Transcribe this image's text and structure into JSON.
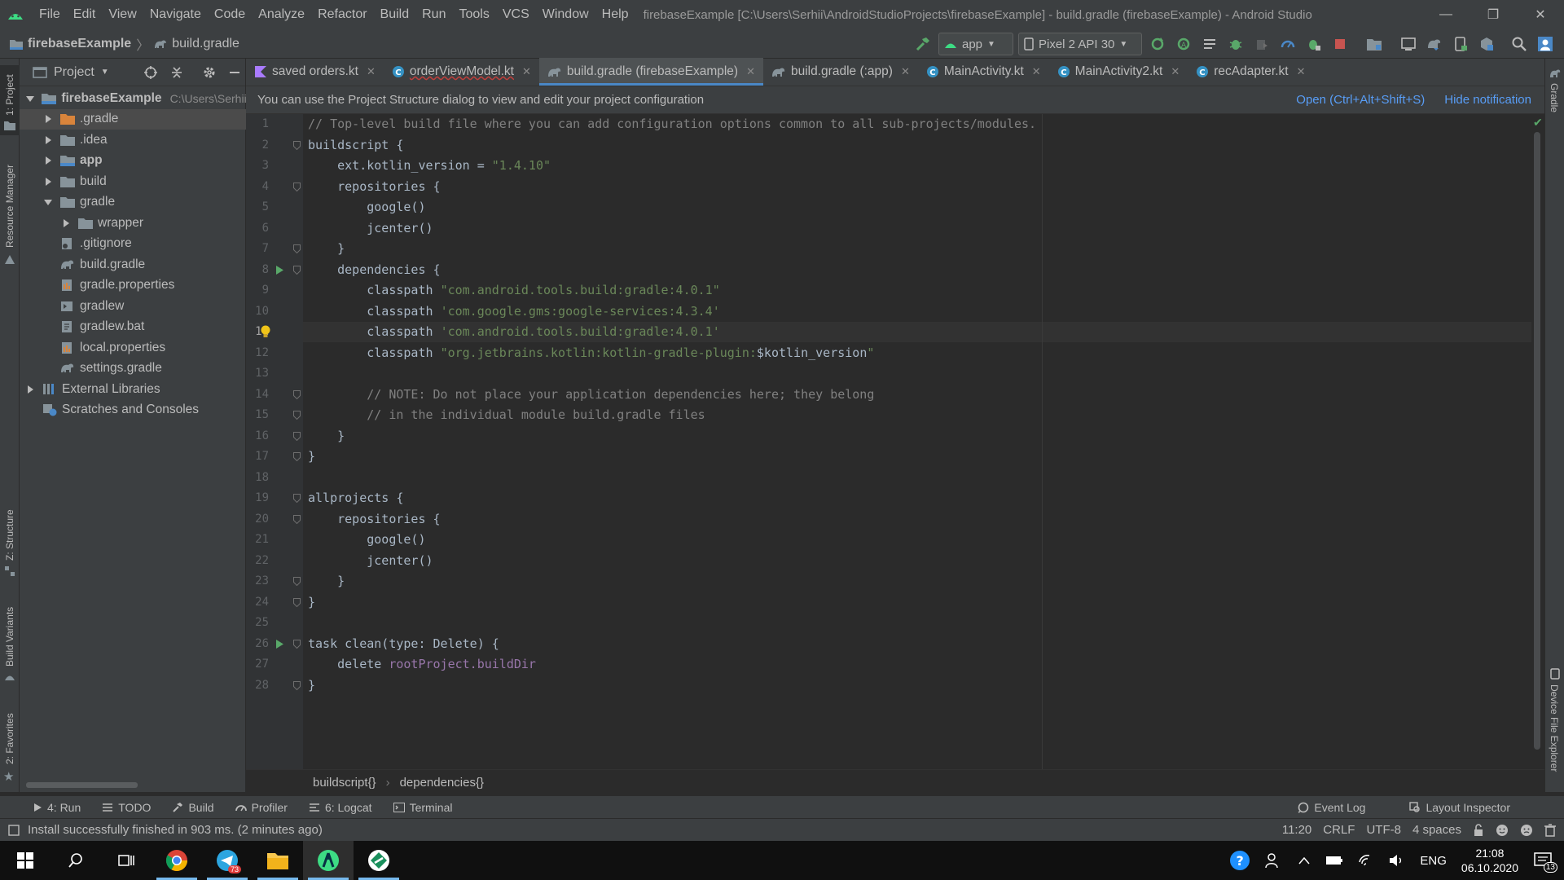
{
  "app": {
    "title": "firebaseExample [C:\\Users\\Serhii\\AndroidStudioProjects\\firebaseExample] - build.gradle (firebaseExample) - Android Studio",
    "menu": [
      "File",
      "Edit",
      "View",
      "Navigate",
      "Code",
      "Analyze",
      "Refactor",
      "Build",
      "Run",
      "Tools",
      "VCS",
      "Window",
      "Help"
    ],
    "window_controls": {
      "minimize": "—",
      "restore": "❐",
      "close": "✕"
    }
  },
  "navbar": {
    "project": "firebaseExample",
    "file": "build.gradle",
    "run_config": "app",
    "device": "Pixel 2 API 30"
  },
  "left_stripe": [
    "1: Project",
    "Resource Manager",
    "Z: Structure",
    "Build Variants",
    "2: Favorites"
  ],
  "right_stripe": [
    "Gradle",
    "Device File Explorer"
  ],
  "project_panel": {
    "view": "Project",
    "tree": [
      {
        "label": "firebaseExample",
        "path": "C:\\Users\\Serhii\\",
        "depth": 0,
        "expanded": true,
        "icon": "module-folder-icon",
        "bold": true
      },
      {
        "label": ".gradle",
        "depth": 1,
        "expanded": false,
        "icon": "orange-folder-icon",
        "selected": true
      },
      {
        "label": ".idea",
        "depth": 1,
        "expanded": false,
        "icon": "folder-icon"
      },
      {
        "label": "app",
        "depth": 1,
        "expanded": false,
        "icon": "module-folder-icon",
        "bold": true
      },
      {
        "label": "build",
        "depth": 1,
        "expanded": false,
        "icon": "folder-icon"
      },
      {
        "label": "gradle",
        "depth": 1,
        "expanded": true,
        "icon": "folder-icon"
      },
      {
        "label": "wrapper",
        "depth": 2,
        "expanded": false,
        "icon": "folder-icon"
      },
      {
        "label": ".gitignore",
        "depth": 1,
        "icon": "gitignore-icon"
      },
      {
        "label": "build.gradle",
        "depth": 1,
        "icon": "gradle-icon"
      },
      {
        "label": "gradle.properties",
        "depth": 1,
        "icon": "properties-icon"
      },
      {
        "label": "gradlew",
        "depth": 1,
        "icon": "script-icon"
      },
      {
        "label": "gradlew.bat",
        "depth": 1,
        "icon": "bat-icon"
      },
      {
        "label": "local.properties",
        "depth": 1,
        "icon": "properties-icon"
      },
      {
        "label": "settings.gradle",
        "depth": 1,
        "icon": "gradle-icon"
      },
      {
        "label": "External Libraries",
        "depth": 0,
        "expanded": false,
        "icon": "libraries-icon"
      },
      {
        "label": "Scratches and Consoles",
        "depth": 0,
        "icon": "scratches-icon"
      }
    ]
  },
  "tabs": [
    {
      "label": "saved orders.kt",
      "icon": "kotlin-file-icon"
    },
    {
      "label": "orderViewModel.kt",
      "icon": "kotlin-class-icon",
      "error": true
    },
    {
      "label": "build.gradle (firebaseExample)",
      "icon": "gradle-icon",
      "active": true
    },
    {
      "label": "build.gradle (:app)",
      "icon": "gradle-icon"
    },
    {
      "label": "MainActivity.kt",
      "icon": "kotlin-class-icon"
    },
    {
      "label": "MainActivity2.kt",
      "icon": "kotlin-class-icon"
    },
    {
      "label": "recAdapter.kt",
      "icon": "kotlin-class-icon"
    }
  ],
  "notification": {
    "text": "You can use the Project Structure dialog to view and edit your project configuration",
    "open": "Open (Ctrl+Alt+Shift+S)",
    "hide": "Hide notification"
  },
  "code": {
    "current_line": 11,
    "lines": [
      "// Top-level build file where you can add configuration options common to all sub-projects/modules.",
      "buildscript {",
      "    ext.kotlin_version = \"1.4.10\"",
      "    repositories {",
      "        google()",
      "        jcenter()",
      "    }",
      "    dependencies {",
      "        classpath \"com.android.tools.build:gradle:4.0.1\"",
      "        classpath 'com.google.gms:google-services:4.3.4'",
      "        classpath 'com.android.tools.build:gradle:4.0.1'",
      "        classpath \"org.jetbrains.kotlin:kotlin-gradle-plugin:$kotlin_version\"",
      "",
      "        // NOTE: Do not place your application dependencies here; they belong",
      "        // in the individual module build.gradle files",
      "    }",
      "}",
      "",
      "allprojects {",
      "    repositories {",
      "        google()",
      "        jcenter()",
      "    }",
      "}",
      "",
      "task clean(type: Delete) {",
      "    delete rootProject.buildDir",
      "}"
    ]
  },
  "breadcrumbs": [
    "buildscript{}",
    "dependencies{}"
  ],
  "tool_windows": {
    "left": [
      {
        "label": "4: Run",
        "icon": "run-icon"
      },
      {
        "label": "TODO",
        "icon": "list-icon"
      },
      {
        "label": "Build",
        "icon": "hammer-icon"
      },
      {
        "label": "Profiler",
        "icon": "gauge-icon"
      },
      {
        "label": "6: Logcat",
        "icon": "logcat-icon"
      },
      {
        "label": "Terminal",
        "icon": "terminal-icon"
      }
    ],
    "right": [
      {
        "label": "Event Log",
        "icon": "event-log-icon"
      },
      {
        "label": "Layout Inspector",
        "icon": "layout-inspector-icon"
      }
    ]
  },
  "status": {
    "message": "Install successfully finished in 903 ms. (2 minutes ago)",
    "position": "11:20",
    "line_sep": "CRLF",
    "encoding": "UTF-8",
    "indent": "4 spaces"
  },
  "taskbar": {
    "apps": [
      "windows-start-icon",
      "search-icon",
      "task-view-icon",
      "chrome-icon",
      "telegram-icon",
      "file-explorer-icon",
      "android-studio-icon",
      "app-icon"
    ],
    "telegram_badge": "73",
    "lang": "ENG",
    "time": "21:08",
    "date": "06.10.2020",
    "notifications": "13"
  },
  "colors": {
    "accent": "#4a88c7",
    "link": "#589df6",
    "editor_bg": "#2b2b2b",
    "panel_bg": "#3c3f41",
    "string": "#6a8759",
    "comment": "#808080",
    "keyword": "#cc7832"
  }
}
